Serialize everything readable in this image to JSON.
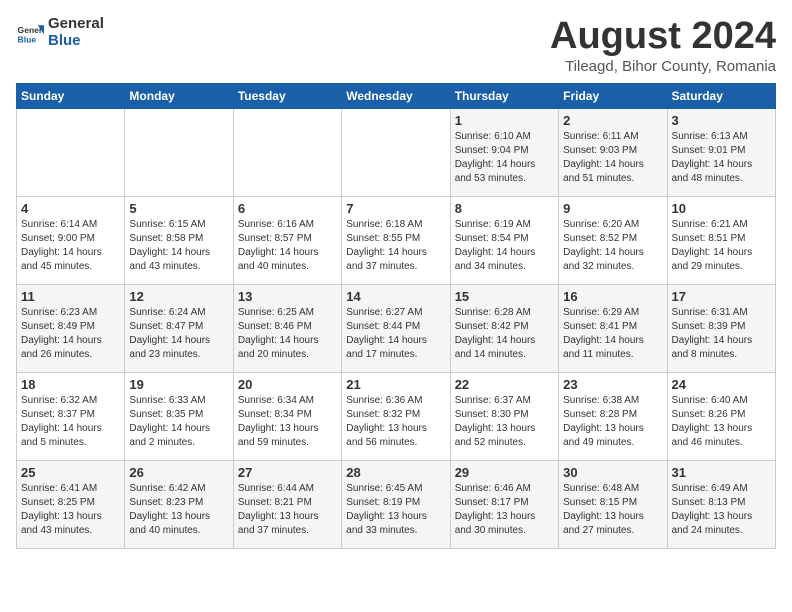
{
  "header": {
    "logo_general": "General",
    "logo_blue": "Blue",
    "title": "August 2024",
    "subtitle": "Tileagd, Bihor County, Romania"
  },
  "calendar": {
    "days_of_week": [
      "Sunday",
      "Monday",
      "Tuesday",
      "Wednesday",
      "Thursday",
      "Friday",
      "Saturday"
    ],
    "weeks": [
      [
        {
          "day": "",
          "info": ""
        },
        {
          "day": "",
          "info": ""
        },
        {
          "day": "",
          "info": ""
        },
        {
          "day": "",
          "info": ""
        },
        {
          "day": "1",
          "info": "Sunrise: 6:10 AM\nSunset: 9:04 PM\nDaylight: 14 hours\nand 53 minutes."
        },
        {
          "day": "2",
          "info": "Sunrise: 6:11 AM\nSunset: 9:03 PM\nDaylight: 14 hours\nand 51 minutes."
        },
        {
          "day": "3",
          "info": "Sunrise: 6:13 AM\nSunset: 9:01 PM\nDaylight: 14 hours\nand 48 minutes."
        }
      ],
      [
        {
          "day": "4",
          "info": "Sunrise: 6:14 AM\nSunset: 9:00 PM\nDaylight: 14 hours\nand 45 minutes."
        },
        {
          "day": "5",
          "info": "Sunrise: 6:15 AM\nSunset: 8:58 PM\nDaylight: 14 hours\nand 43 minutes."
        },
        {
          "day": "6",
          "info": "Sunrise: 6:16 AM\nSunset: 8:57 PM\nDaylight: 14 hours\nand 40 minutes."
        },
        {
          "day": "7",
          "info": "Sunrise: 6:18 AM\nSunset: 8:55 PM\nDaylight: 14 hours\nand 37 minutes."
        },
        {
          "day": "8",
          "info": "Sunrise: 6:19 AM\nSunset: 8:54 PM\nDaylight: 14 hours\nand 34 minutes."
        },
        {
          "day": "9",
          "info": "Sunrise: 6:20 AM\nSunset: 8:52 PM\nDaylight: 14 hours\nand 32 minutes."
        },
        {
          "day": "10",
          "info": "Sunrise: 6:21 AM\nSunset: 8:51 PM\nDaylight: 14 hours\nand 29 minutes."
        }
      ],
      [
        {
          "day": "11",
          "info": "Sunrise: 6:23 AM\nSunset: 8:49 PM\nDaylight: 14 hours\nand 26 minutes."
        },
        {
          "day": "12",
          "info": "Sunrise: 6:24 AM\nSunset: 8:47 PM\nDaylight: 14 hours\nand 23 minutes."
        },
        {
          "day": "13",
          "info": "Sunrise: 6:25 AM\nSunset: 8:46 PM\nDaylight: 14 hours\nand 20 minutes."
        },
        {
          "day": "14",
          "info": "Sunrise: 6:27 AM\nSunset: 8:44 PM\nDaylight: 14 hours\nand 17 minutes."
        },
        {
          "day": "15",
          "info": "Sunrise: 6:28 AM\nSunset: 8:42 PM\nDaylight: 14 hours\nand 14 minutes."
        },
        {
          "day": "16",
          "info": "Sunrise: 6:29 AM\nSunset: 8:41 PM\nDaylight: 14 hours\nand 11 minutes."
        },
        {
          "day": "17",
          "info": "Sunrise: 6:31 AM\nSunset: 8:39 PM\nDaylight: 14 hours\nand 8 minutes."
        }
      ],
      [
        {
          "day": "18",
          "info": "Sunrise: 6:32 AM\nSunset: 8:37 PM\nDaylight: 14 hours\nand 5 minutes."
        },
        {
          "day": "19",
          "info": "Sunrise: 6:33 AM\nSunset: 8:35 PM\nDaylight: 14 hours\nand 2 minutes."
        },
        {
          "day": "20",
          "info": "Sunrise: 6:34 AM\nSunset: 8:34 PM\nDaylight: 13 hours\nand 59 minutes."
        },
        {
          "day": "21",
          "info": "Sunrise: 6:36 AM\nSunset: 8:32 PM\nDaylight: 13 hours\nand 56 minutes."
        },
        {
          "day": "22",
          "info": "Sunrise: 6:37 AM\nSunset: 8:30 PM\nDaylight: 13 hours\nand 52 minutes."
        },
        {
          "day": "23",
          "info": "Sunrise: 6:38 AM\nSunset: 8:28 PM\nDaylight: 13 hours\nand 49 minutes."
        },
        {
          "day": "24",
          "info": "Sunrise: 6:40 AM\nSunset: 8:26 PM\nDaylight: 13 hours\nand 46 minutes."
        }
      ],
      [
        {
          "day": "25",
          "info": "Sunrise: 6:41 AM\nSunset: 8:25 PM\nDaylight: 13 hours\nand 43 minutes."
        },
        {
          "day": "26",
          "info": "Sunrise: 6:42 AM\nSunset: 8:23 PM\nDaylight: 13 hours\nand 40 minutes."
        },
        {
          "day": "27",
          "info": "Sunrise: 6:44 AM\nSunset: 8:21 PM\nDaylight: 13 hours\nand 37 minutes."
        },
        {
          "day": "28",
          "info": "Sunrise: 6:45 AM\nSunset: 8:19 PM\nDaylight: 13 hours\nand 33 minutes."
        },
        {
          "day": "29",
          "info": "Sunrise: 6:46 AM\nSunset: 8:17 PM\nDaylight: 13 hours\nand 30 minutes."
        },
        {
          "day": "30",
          "info": "Sunrise: 6:48 AM\nSunset: 8:15 PM\nDaylight: 13 hours\nand 27 minutes."
        },
        {
          "day": "31",
          "info": "Sunrise: 6:49 AM\nSunset: 8:13 PM\nDaylight: 13 hours\nand 24 minutes."
        }
      ]
    ]
  }
}
